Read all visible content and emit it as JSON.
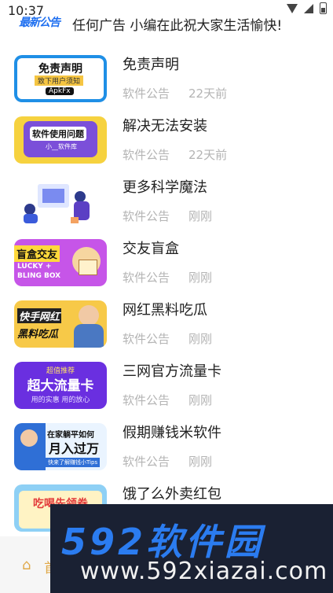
{
  "status_bar": {
    "time": "10:37"
  },
  "notice": {
    "logo": "最新公告",
    "text": "任何广告 小编在此祝大家生活愉快!"
  },
  "items": [
    {
      "title": "免责声明",
      "category": "软件公告",
      "time": "22天前",
      "thumb": {
        "text1": "免责声明",
        "text2": "致下用户须知",
        "text3": "ApkFx"
      }
    },
    {
      "title": "解决无法安装",
      "category": "软件公告",
      "time": "22天前",
      "thumb": {
        "text1": "软件使用问题",
        "text2": "小__软件库"
      }
    },
    {
      "title": "更多科学魔法",
      "category": "软件公告",
      "time": "刚刚",
      "thumb": {}
    },
    {
      "title": "交友盲盒",
      "category": "软件公告",
      "time": "刚刚",
      "thumb": {
        "text1": "盲盒交友",
        "text2": "LUCKY +",
        "text3": "BLING BOX"
      }
    },
    {
      "title": "网红黑料吃瓜",
      "category": "软件公告",
      "time": "刚刚",
      "thumb": {
        "text1": "快手网红",
        "text2": "黑料吃瓜"
      }
    },
    {
      "title": "三网官方流量卡",
      "category": "软件公告",
      "time": "刚刚",
      "thumb": {
        "text1": "超值推荐",
        "text2": "超大流量卡",
        "text3": "用的实惠 用的放心"
      }
    },
    {
      "title": "假期赚钱米软件",
      "category": "软件公告",
      "time": "刚刚",
      "thumb": {
        "text1": "在家躺平如何",
        "text2": "月入过万",
        "text3": "快来了解赚钱小Tips"
      }
    },
    {
      "title": "饿了么外卖红包",
      "category": "",
      "time": "",
      "thumb": {
        "text1": "吃喝先领券"
      }
    }
  ],
  "bottom_nav": {
    "home_label": "首页"
  },
  "watermark": {
    "line1": "592软件园",
    "line2": "www.592xiazai.com"
  }
}
